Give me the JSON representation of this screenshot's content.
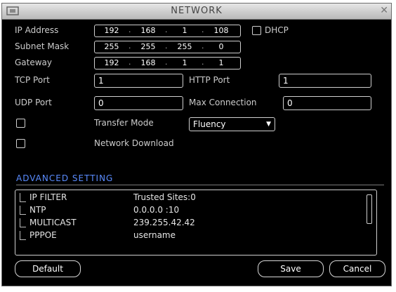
{
  "window": {
    "title": "NETWORK"
  },
  "fields": {
    "ip_label": "IP Address",
    "ip": [
      "192",
      "168",
      "1",
      "108"
    ],
    "dhcp_label": "DHCP",
    "mask_label": "Subnet Mask",
    "mask": [
      "255",
      "255",
      "255",
      "0"
    ],
    "gw_label": "Gateway",
    "gw": [
      "192",
      "168",
      "1",
      "1"
    ],
    "tcp_label": "TCP Port",
    "tcp_value": "1",
    "http_label": "HTTP Port",
    "http_value": "1",
    "udp_label": "UDP Port",
    "udp_value": "0",
    "maxconn_label": "Max Connection",
    "maxconn_value": "0",
    "transfer_label": "Transfer Mode",
    "transfer_value": "Fluency",
    "download_label": "Network Download"
  },
  "advanced": {
    "header": "ADVANCED SETTING",
    "rows": [
      {
        "name": "IP FILTER",
        "value": "Trusted Sites:0"
      },
      {
        "name": "NTP",
        "value": "0.0.0.0 :10"
      },
      {
        "name": "MULTICAST",
        "value": "239.255.42.42"
      },
      {
        "name": "PPPOE",
        "value": "username"
      }
    ]
  },
  "buttons": {
    "default": "Default",
    "save": "Save",
    "cancel": "Cancel"
  }
}
